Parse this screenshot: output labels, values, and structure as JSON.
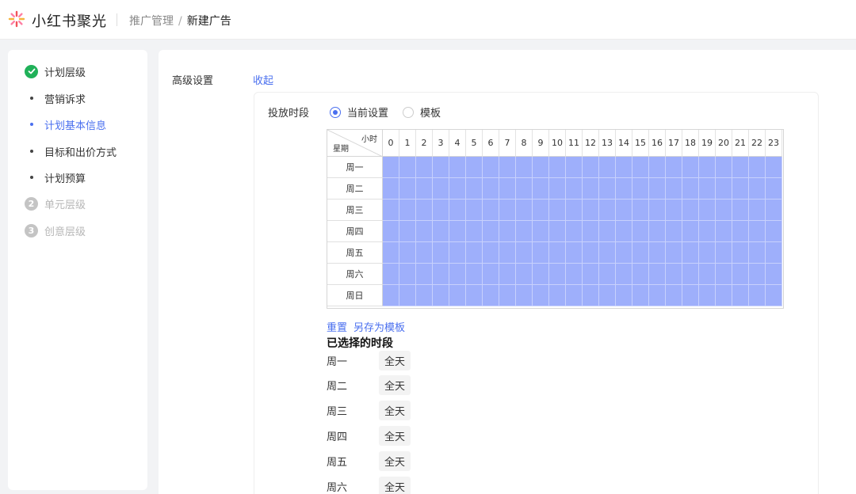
{
  "header": {
    "brand": "小红书聚光",
    "breadcrumb": {
      "parent": "推广管理",
      "separator": "/",
      "current": "新建广告"
    }
  },
  "colors": {
    "accent": "#4a6fef",
    "done": "#20b159",
    "selected_cell": "#9eaffb"
  },
  "steps": {
    "level1": {
      "label": "计划层级",
      "icon": "check-icon"
    },
    "subs": [
      {
        "label": "营销诉求"
      },
      {
        "label": "计划基本信息"
      },
      {
        "label": "目标和出价方式"
      },
      {
        "label": "计划预算"
      }
    ],
    "level2": {
      "num": "2",
      "label": "单元层级"
    },
    "level3": {
      "num": "3",
      "label": "创意层级"
    }
  },
  "advanced": {
    "label": "高级设置",
    "toggle": "收起"
  },
  "period": {
    "label": "投放时段",
    "options": [
      {
        "label": "当前设置",
        "selected": true
      },
      {
        "label": "模板",
        "selected": false
      }
    ]
  },
  "grid": {
    "corner_week": "星期",
    "corner_hour": "小时",
    "hours": [
      "0",
      "1",
      "2",
      "3",
      "4",
      "5",
      "6",
      "7",
      "8",
      "9",
      "10",
      "11",
      "12",
      "13",
      "14",
      "15",
      "16",
      "17",
      "18",
      "19",
      "20",
      "21",
      "22",
      "23"
    ],
    "days": [
      "周一",
      "周二",
      "周三",
      "周四",
      "周五",
      "周六",
      "周日"
    ]
  },
  "actions": {
    "reset": "重置",
    "save_template": "另存为模板"
  },
  "selected": {
    "title": "已选择的时段",
    "rows": [
      {
        "day": "周一",
        "value": "全天"
      },
      {
        "day": "周二",
        "value": "全天"
      },
      {
        "day": "周三",
        "value": "全天"
      },
      {
        "day": "周四",
        "value": "全天"
      },
      {
        "day": "周五",
        "value": "全天"
      },
      {
        "day": "周六",
        "value": "全天"
      }
    ]
  }
}
